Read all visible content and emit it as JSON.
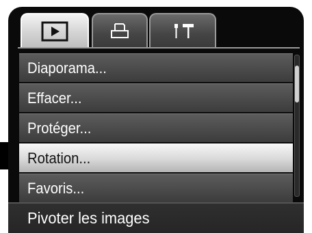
{
  "tabs": [
    {
      "icon": "play-icon",
      "active": true
    },
    {
      "icon": "print-icon",
      "active": false
    },
    {
      "icon": "tools-icon",
      "active": false
    }
  ],
  "menu": {
    "items": [
      {
        "label": "Diaporama..."
      },
      {
        "label": "Effacer..."
      },
      {
        "label": "Protéger..."
      },
      {
        "label": "Rotation...",
        "selected": true
      },
      {
        "label": "Favoris..."
      }
    ]
  },
  "hint": {
    "text": "Pivoter les images"
  },
  "colors": {
    "highlight": "#d8d8d8",
    "item_bg": "#4a4a4a",
    "panel_bg": "#0a0a0a"
  }
}
